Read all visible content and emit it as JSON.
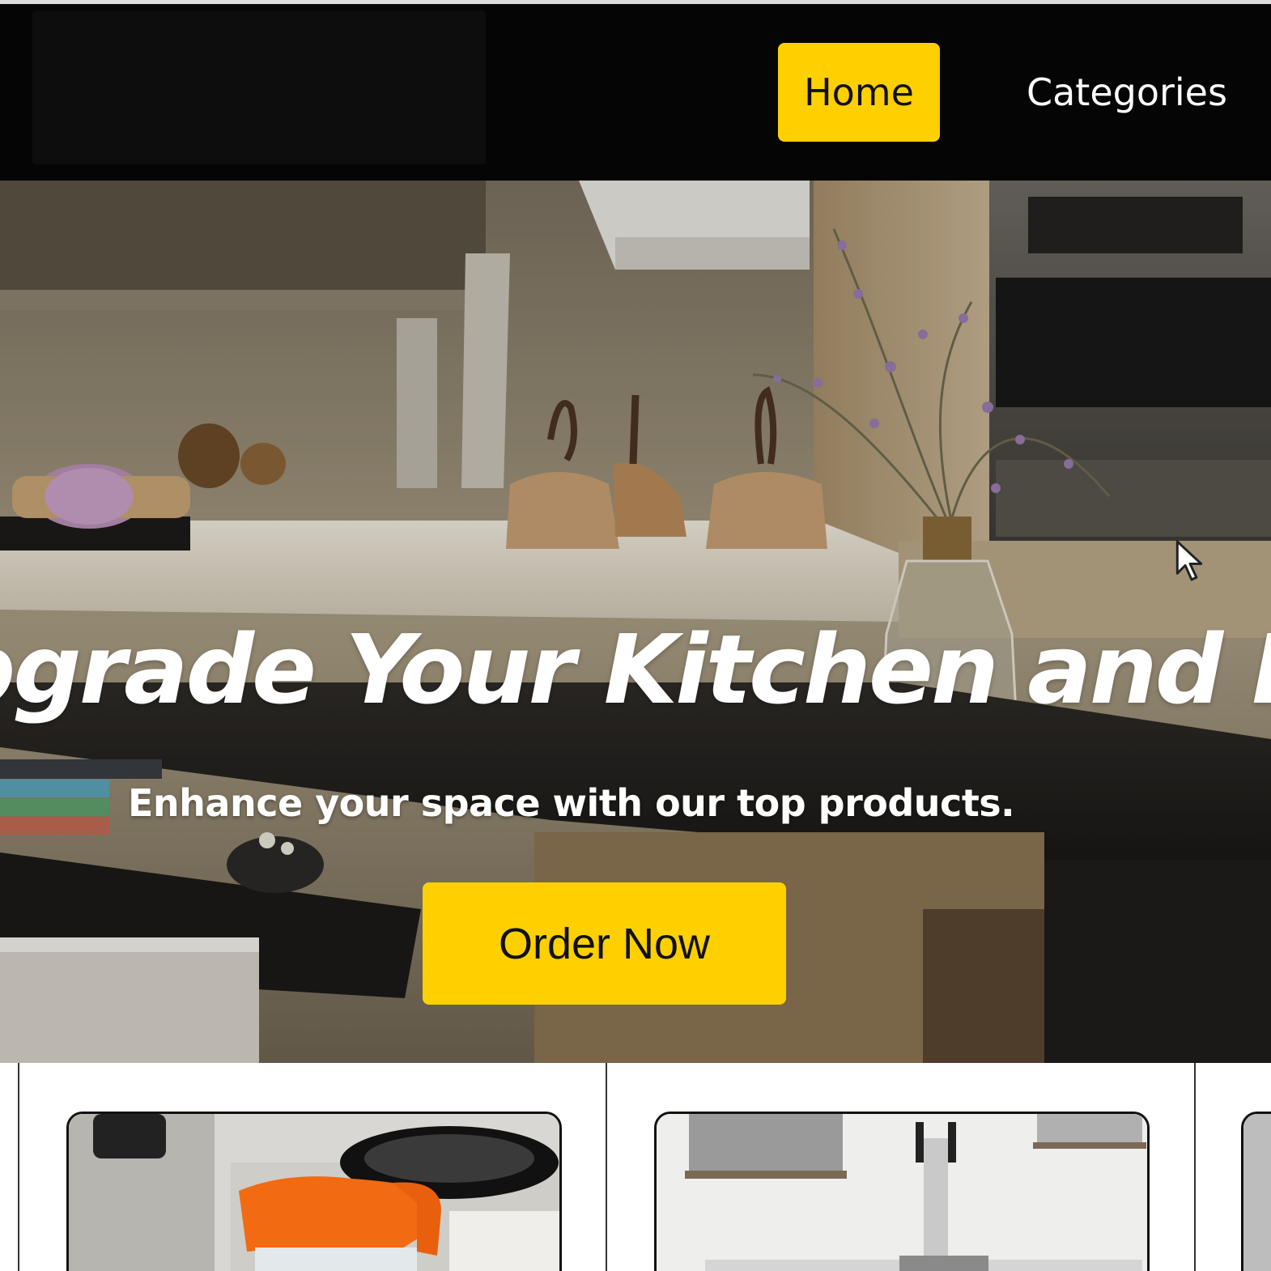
{
  "navbar": {
    "items": [
      {
        "label": "Home",
        "active": true
      },
      {
        "label": "Categories",
        "active": false
      }
    ]
  },
  "hero": {
    "title": "Upgrade Your Kitchen and Home",
    "subtitle": "Enhance your space with our top products.",
    "cta_label": "Order Now"
  },
  "products": {
    "images": [
      "coffee-decanter-image",
      "beer-tap-image"
    ]
  },
  "colors": {
    "accent": "#ffd000",
    "navbar_bg": "#050505",
    "text_on_dark": "#ffffff",
    "text_on_accent": "#111111"
  }
}
